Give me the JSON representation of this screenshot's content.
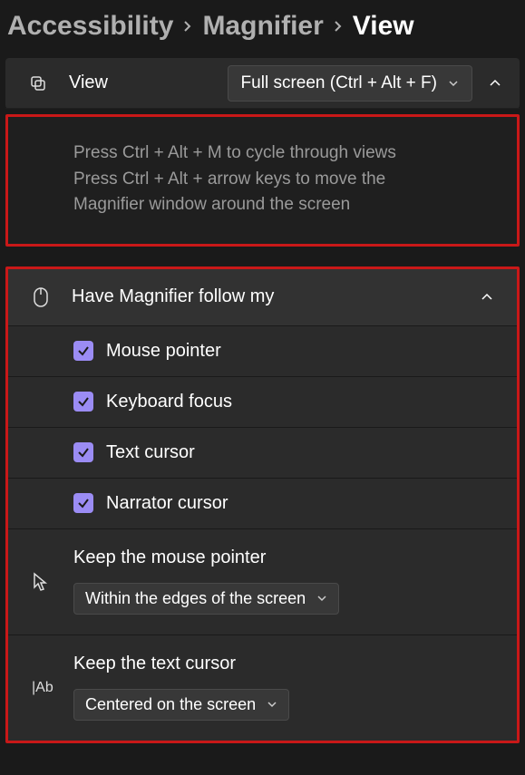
{
  "breadcrumb": {
    "items": [
      "Accessibility",
      "Magnifier",
      "View"
    ],
    "active_index": 2
  },
  "view_setting": {
    "label": "View",
    "dropdown_value": "Full screen (Ctrl + Alt + F)"
  },
  "hint": {
    "line1": "Press Ctrl + Alt + M to cycle through views",
    "line2": "Press Ctrl + Alt + arrow keys to move the",
    "line3": "Magnifier window around the screen"
  },
  "follow": {
    "header_label": "Have Magnifier follow my",
    "checkboxes": [
      {
        "label": "Mouse pointer",
        "checked": true
      },
      {
        "label": "Keyboard focus",
        "checked": true
      },
      {
        "label": "Text cursor",
        "checked": true
      },
      {
        "label": "Narrator cursor",
        "checked": true
      }
    ],
    "mouse_sub": {
      "label": "Keep the mouse pointer",
      "value": "Within the edges of the screen"
    },
    "text_sub": {
      "label": "Keep the text cursor",
      "value": "Centered on the screen"
    }
  }
}
